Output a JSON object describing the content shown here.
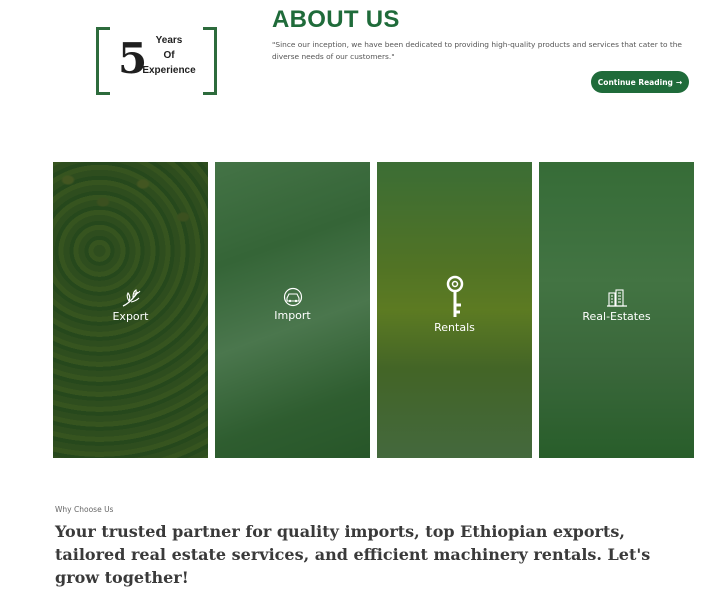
{
  "badge": {
    "number": "5",
    "line1": "Years",
    "line2": "Of",
    "line3": "Experience"
  },
  "about": {
    "title": "ABOUT US",
    "text": "\"Since our inception, we have been dedicated to providing high-quality products and services that cater to the diverse needs of our customers.\"",
    "button_label": "Continue Reading",
    "button_arrow": "→"
  },
  "cards": [
    {
      "label": "Export",
      "icon": "plant-icon"
    },
    {
      "label": "Import",
      "icon": "car-icon"
    },
    {
      "label": "Rentals",
      "icon": "key-icon"
    },
    {
      "label": "Real-Estates",
      "icon": "buildings-icon"
    }
  ],
  "why": {
    "label": "Why Choose Us",
    "heading": "Your trusted partner for quality imports, top Ethiopian exports, tailored real estate services, and efficient machinery rentals. Let's grow together!"
  },
  "colors": {
    "brand_green": "#1f6b3a",
    "overlay_green": "#226028"
  }
}
